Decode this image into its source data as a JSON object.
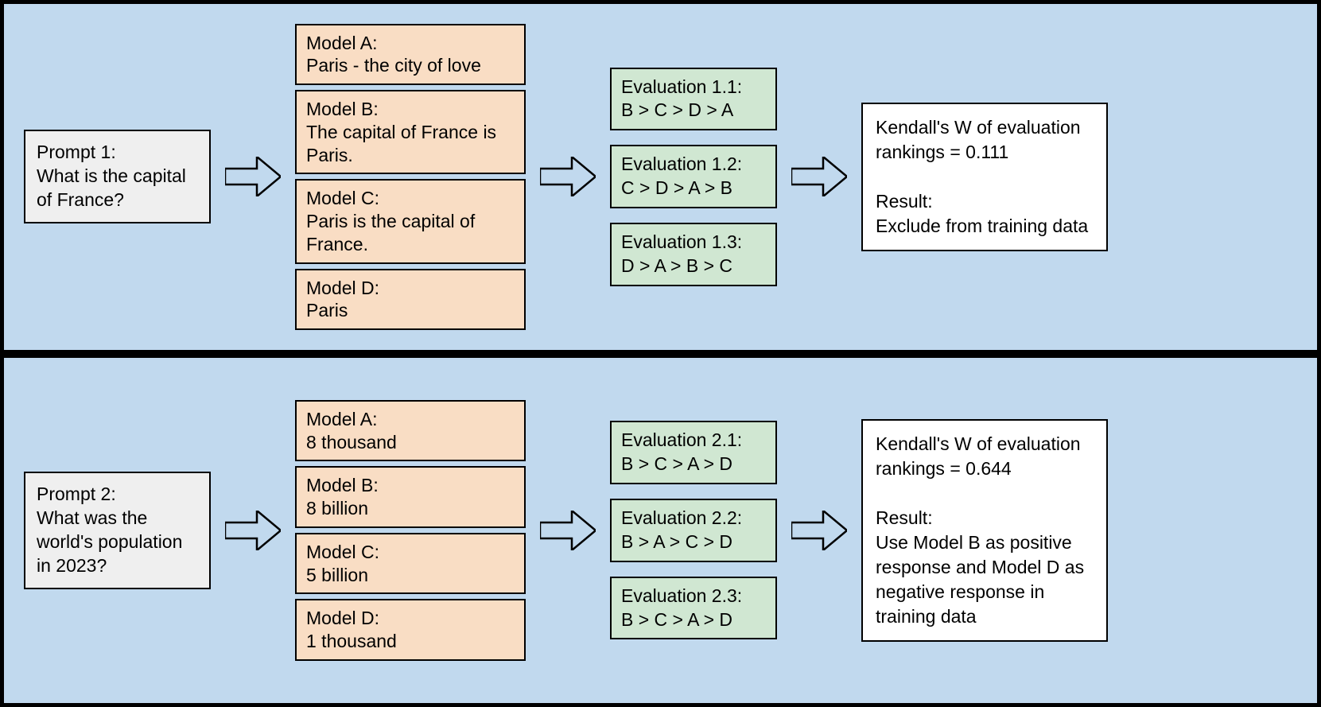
{
  "panel1": {
    "prompt": "Prompt 1:\nWhat is the capital of France?",
    "models": [
      "Model A:\nParis - the city of love",
      "Model B:\nThe capital of France is Paris.",
      "Model C:\nParis is the capital of France.",
      "Model D:\nParis"
    ],
    "evals": [
      "Evaluation 1.1:\nB > C > D > A",
      "Evaluation 1.2:\nC > D > A > B",
      "Evaluation 1.3:\nD > A > B > C"
    ],
    "result": "Kendall's W of evaluation rankings = 0.111\n\nResult:\nExclude from training data"
  },
  "panel2": {
    "prompt": "Prompt 2:\nWhat was the world's population in 2023?",
    "models": [
      "Model A:\n8 thousand",
      "Model B:\n8 billion",
      "Model C:\n5 billion",
      "Model D:\n1 thousand"
    ],
    "evals": [
      "Evaluation 2.1:\nB > C > A > D",
      "Evaluation 2.2:\nB > A > C > D",
      "Evaluation 2.3:\nB > C > A > D"
    ],
    "result": "Kendall's W of evaluation rankings = 0.644\n\nResult:\nUse Model B as positive response and Model D as negative response in training data"
  },
  "chart_data": {
    "type": "table",
    "title": "Evaluation ranking agreement diagram",
    "rows": [
      {
        "prompt": "What is the capital of France?",
        "model_responses": {
          "A": "Paris - the city of love",
          "B": "The capital of France is Paris.",
          "C": "Paris is the capital of France.",
          "D": "Paris"
        },
        "evaluation_rankings": [
          "B>C>D>A",
          "C>D>A>B",
          "D>A>B>C"
        ],
        "kendalls_w": 0.111,
        "result": "Exclude from training data"
      },
      {
        "prompt": "What was the world's population in 2023?",
        "model_responses": {
          "A": "8 thousand",
          "B": "8 billion",
          "C": "5 billion",
          "D": "1 thousand"
        },
        "evaluation_rankings": [
          "B>C>A>D",
          "B>A>C>D",
          "B>C>A>D"
        ],
        "kendalls_w": 0.644,
        "result": "Use Model B as positive response and Model D as negative response in training data"
      }
    ]
  }
}
